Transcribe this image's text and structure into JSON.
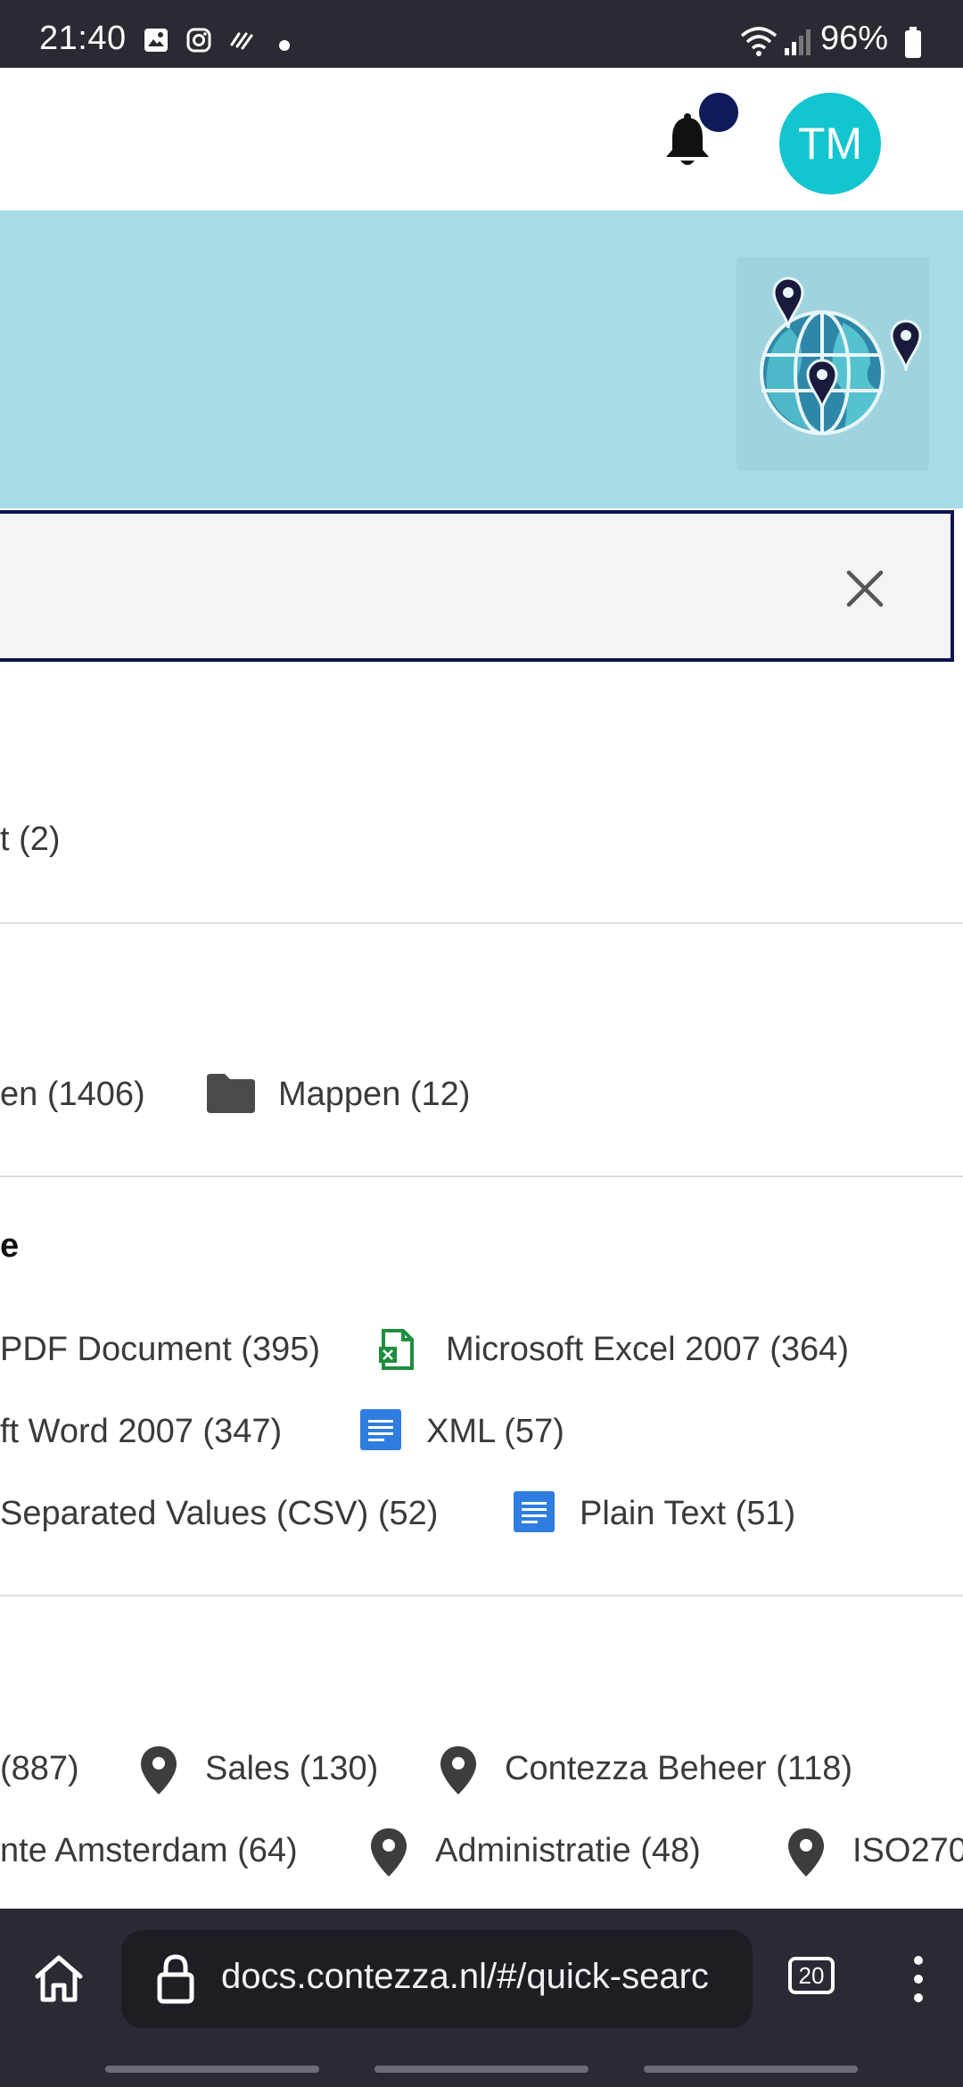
{
  "status_bar": {
    "time": "21:40",
    "battery": "96%"
  },
  "header": {
    "avatar_initials": "TM"
  },
  "search": {
    "value": "",
    "placeholder": ""
  },
  "facets": {
    "row1": {
      "text": "t (2)"
    },
    "kind": {
      "items": [
        {
          "label": "en (1406)"
        },
        {
          "label": "Mappen (12)"
        }
      ]
    },
    "type": {
      "title": "e",
      "rows": [
        [
          {
            "label": "PDF Document (395)"
          },
          {
            "label": "Microsoft Excel 2007 (364)"
          }
        ],
        [
          {
            "label": "ft Word 2007 (347)"
          },
          {
            "label": "XML (57)"
          }
        ],
        [
          {
            "label": " Separated Values (CSV) (52)"
          },
          {
            "label": "Plain Text (51)"
          }
        ]
      ]
    },
    "location": {
      "rows": [
        [
          {
            "label": "(887)"
          },
          {
            "label": "Sales (130)"
          },
          {
            "label": "Contezza Beheer (118)"
          }
        ],
        [
          {
            "label": "nte Amsterdam (64)"
          },
          {
            "label": "Administratie (48)"
          },
          {
            "label": "ISO270"
          }
        ]
      ]
    }
  },
  "browser": {
    "url": "docs.contezza.nl/#/quick-searc",
    "tab_count": "20"
  },
  "colors": {
    "banner": "#a7dce6",
    "avatar": "#13c5cf",
    "notification_dot": "#0e1a5a",
    "excel_green": "#1e8e3e",
    "doc_blue": "#2f7de1"
  }
}
